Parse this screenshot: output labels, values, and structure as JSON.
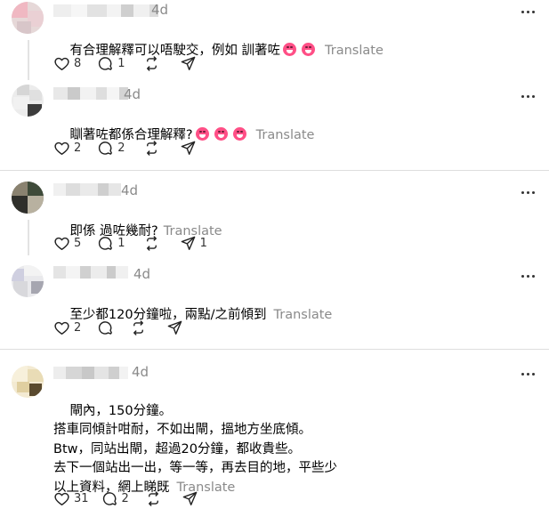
{
  "posts": [
    {
      "time": "4d",
      "text": "有合理解釋可以唔駛交，例如 訓著咗",
      "translate": "Translate",
      "likes": "8",
      "replies": "1",
      "reposts": "",
      "shares": ""
    },
    {
      "time": "4d",
      "text": "瞓著咗都係合理解釋?",
      "translate": "Translate",
      "likes": "2",
      "replies": "2",
      "reposts": "",
      "shares": ""
    },
    {
      "time": "4d",
      "text": "即係 過咗幾耐?",
      "translate": "Translate",
      "likes": "5",
      "replies": "1",
      "reposts": "",
      "shares": "1"
    },
    {
      "time": "4d",
      "text": "至少都120分鐘啦，兩點/之前傾到",
      "translate": "Translate",
      "likes": "2",
      "replies": "",
      "reposts": "",
      "shares": ""
    },
    {
      "time": "4d",
      "text": "閘內，150分鐘。\n搭車同傾計咁耐，不如出閘，搵地方坐底傾。\nBtw，同站出閘，超過20分鐘，都收貴些。\n去下一個站出一出，等一等，再去目的地，平些少\n以上資料，網上睇既",
      "translate": "Translate",
      "likes": "31",
      "replies": "2",
      "reposts": "",
      "shares": ""
    }
  ],
  "icons": {
    "like": "heart-icon",
    "reply": "comment-icon",
    "repost": "repost-icon",
    "share": "send-icon",
    "more": "more-icon",
    "emoji": "laughing-emoji-icon"
  },
  "colors": {
    "muted": "#8a8a8a",
    "divider": "#dedede",
    "emoji": "#ff4f86"
  }
}
